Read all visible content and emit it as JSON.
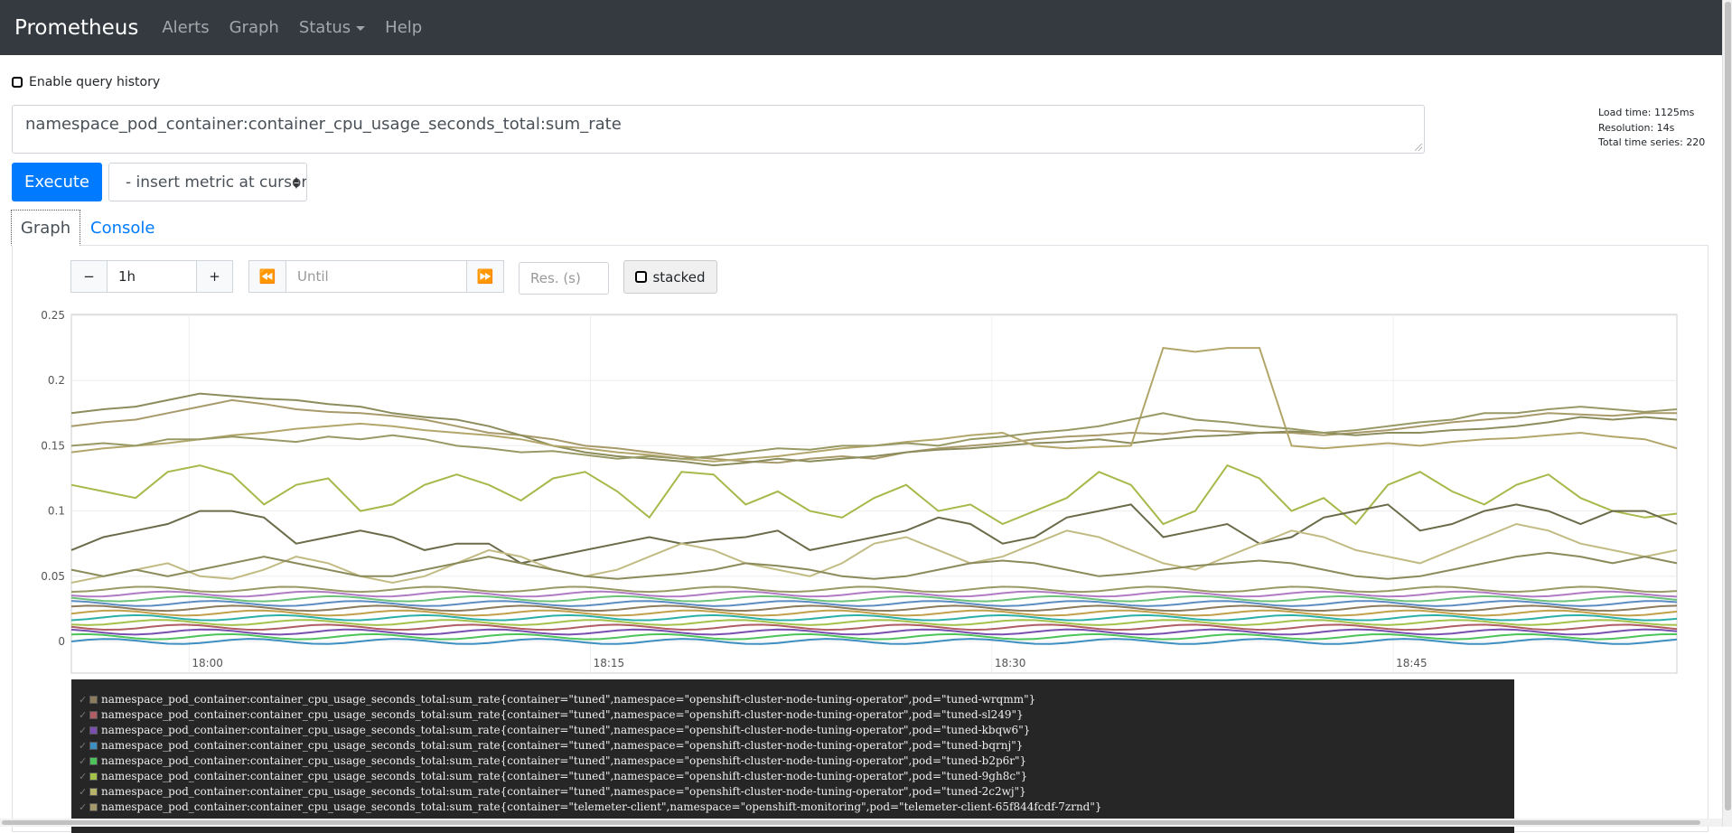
{
  "navbar": {
    "brand": "Prometheus",
    "links": [
      "Alerts",
      "Graph",
      "Status",
      "Help"
    ]
  },
  "query": {
    "history_label": "Enable query history",
    "history_checked": false,
    "expression": "namespace_pod_container:container_cpu_usage_seconds_total:sum_rate",
    "execute_label": "Execute",
    "metric_select_label": "- insert metric at cursor -",
    "stats": {
      "load_time": "Load time: 1125ms",
      "resolution": "Resolution: 14s",
      "total_series": "Total time series: 220"
    }
  },
  "tabs": {
    "graph": "Graph",
    "console": "Console"
  },
  "graph_controls": {
    "minus": "−",
    "range": "1h",
    "plus": "+",
    "back_icon": "double-left-icon",
    "until_placeholder": "Until",
    "forward_icon": "double-right-icon",
    "res_placeholder": "Res. (s)",
    "stacked_label": "stacked",
    "stacked_checked": false
  },
  "chart_data": {
    "type": "line",
    "y_ticks": [
      "0",
      "0.05",
      "0.1",
      "0.15",
      "0.2",
      "0.25"
    ],
    "ylim": [
      0,
      0.25
    ],
    "x_ticks": [
      "18:00",
      "18:15",
      "18:30",
      "18:45"
    ],
    "x_tick_minutes": [
      4.4,
      19.4,
      34.4,
      49.4
    ],
    "x_range_minutes": [
      0,
      60
    ],
    "grid": true,
    "series_count_shown": 220,
    "series": [
      {
        "color": "#a89a6a",
        "values": [
          0.165,
          0.168,
          0.17,
          0.175,
          0.18,
          0.185,
          0.182,
          0.178,
          0.176,
          0.175,
          0.173,
          0.17,
          0.165,
          0.16,
          0.158,
          0.155,
          0.15,
          0.148,
          0.145,
          0.142,
          0.14,
          0.138,
          0.137,
          0.14,
          0.142,
          0.14,
          0.145,
          0.148,
          0.15,
          0.152,
          0.155,
          0.157,
          0.158,
          0.16,
          0.159,
          0.162,
          0.161,
          0.16,
          0.16,
          0.158,
          0.16,
          0.162,
          0.165,
          0.168,
          0.17,
          0.172,
          0.175,
          0.174,
          0.173,
          0.175,
          0.175
        ]
      },
      {
        "color": "#8c8c5c",
        "values": [
          0.175,
          0.178,
          0.18,
          0.185,
          0.19,
          0.188,
          0.186,
          0.185,
          0.182,
          0.18,
          0.175,
          0.172,
          0.17,
          0.165,
          0.158,
          0.15,
          0.145,
          0.142,
          0.14,
          0.138,
          0.135,
          0.137,
          0.14,
          0.138,
          0.14,
          0.142,
          0.145,
          0.147,
          0.148,
          0.15,
          0.152,
          0.153,
          0.155,
          0.152,
          0.155,
          0.157,
          0.158,
          0.16,
          0.161,
          0.16,
          0.158,
          0.16,
          0.16,
          0.162,
          0.163,
          0.165,
          0.168,
          0.172,
          0.17,
          0.172,
          0.17
        ]
      },
      {
        "color": "#b3a66a",
        "values": [
          0.145,
          0.148,
          0.15,
          0.152,
          0.155,
          0.158,
          0.16,
          0.163,
          0.165,
          0.167,
          0.165,
          0.162,
          0.16,
          0.158,
          0.155,
          0.15,
          0.148,
          0.145,
          0.143,
          0.14,
          0.138,
          0.14,
          0.142,
          0.145,
          0.148,
          0.15,
          0.153,
          0.155,
          0.158,
          0.16,
          0.15,
          0.148,
          0.149,
          0.15,
          0.225,
          0.222,
          0.225,
          0.225,
          0.15,
          0.148,
          0.15,
          0.152,
          0.15,
          0.153,
          0.155,
          0.156,
          0.158,
          0.16,
          0.157,
          0.155,
          0.148
        ]
      },
      {
        "color": "#999966",
        "values": [
          0.15,
          0.152,
          0.15,
          0.155,
          0.155,
          0.157,
          0.155,
          0.153,
          0.157,
          0.155,
          0.158,
          0.155,
          0.15,
          0.148,
          0.145,
          0.146,
          0.143,
          0.14,
          0.142,
          0.14,
          0.142,
          0.145,
          0.148,
          0.147,
          0.15,
          0.15,
          0.152,
          0.15,
          0.155,
          0.157,
          0.16,
          0.162,
          0.165,
          0.17,
          0.175,
          0.17,
          0.168,
          0.165,
          0.163,
          0.16,
          0.162,
          0.165,
          0.168,
          0.17,
          0.175,
          0.175,
          0.178,
          0.18,
          0.178,
          0.176,
          0.178
        ]
      },
      {
        "color": "#a8b84a",
        "values": [
          0.12,
          0.115,
          0.11,
          0.13,
          0.135,
          0.128,
          0.105,
          0.12,
          0.125,
          0.1,
          0.105,
          0.12,
          0.128,
          0.12,
          0.108,
          0.125,
          0.13,
          0.115,
          0.095,
          0.13,
          0.128,
          0.105,
          0.115,
          0.1,
          0.095,
          0.11,
          0.12,
          0.1,
          0.105,
          0.09,
          0.1,
          0.11,
          0.13,
          0.12,
          0.09,
          0.1,
          0.135,
          0.125,
          0.1,
          0.11,
          0.09,
          0.12,
          0.13,
          0.115,
          0.105,
          0.12,
          0.128,
          0.11,
          0.1,
          0.095,
          0.098
        ]
      },
      {
        "color": "#6b6b4a",
        "values": [
          0.07,
          0.08,
          0.085,
          0.09,
          0.1,
          0.1,
          0.095,
          0.075,
          0.08,
          0.085,
          0.08,
          0.07,
          0.075,
          0.075,
          0.06,
          0.065,
          0.07,
          0.075,
          0.08,
          0.075,
          0.078,
          0.08,
          0.085,
          0.07,
          0.075,
          0.08,
          0.085,
          0.095,
          0.09,
          0.075,
          0.08,
          0.095,
          0.1,
          0.105,
          0.08,
          0.085,
          0.09,
          0.075,
          0.08,
          0.095,
          0.1,
          0.105,
          0.085,
          0.09,
          0.1,
          0.105,
          0.1,
          0.09,
          0.1,
          0.1,
          0.09
        ]
      },
      {
        "color": "#c2bb84",
        "values": [
          0.045,
          0.05,
          0.055,
          0.06,
          0.05,
          0.048,
          0.055,
          0.065,
          0.06,
          0.05,
          0.045,
          0.05,
          0.06,
          0.07,
          0.065,
          0.055,
          0.05,
          0.055,
          0.065,
          0.075,
          0.07,
          0.06,
          0.055,
          0.05,
          0.06,
          0.075,
          0.08,
          0.07,
          0.06,
          0.065,
          0.075,
          0.085,
          0.08,
          0.07,
          0.06,
          0.055,
          0.065,
          0.075,
          0.085,
          0.08,
          0.07,
          0.065,
          0.06,
          0.07,
          0.08,
          0.09,
          0.085,
          0.075,
          0.07,
          0.065,
          0.07
        ]
      },
      {
        "color": "#8a8a5a",
        "values": [
          0.055,
          0.05,
          0.055,
          0.05,
          0.055,
          0.06,
          0.065,
          0.06,
          0.055,
          0.05,
          0.05,
          0.055,
          0.06,
          0.065,
          0.06,
          0.055,
          0.05,
          0.048,
          0.05,
          0.052,
          0.055,
          0.06,
          0.058,
          0.055,
          0.05,
          0.048,
          0.05,
          0.055,
          0.06,
          0.062,
          0.06,
          0.055,
          0.05,
          0.052,
          0.055,
          0.058,
          0.06,
          0.062,
          0.06,
          0.055,
          0.05,
          0.048,
          0.05,
          0.055,
          0.06,
          0.065,
          0.068,
          0.065,
          0.06,
          0.065,
          0.06
        ]
      }
    ],
    "flat_series_count": 12,
    "flat_band_range": [
      0.0,
      0.04
    ]
  },
  "legend": {
    "items": [
      {
        "label": "namespace_pod_container:container_cpu_usage_seconds_total:sum_rate{container=\"tuned\",namespace=\"openshift-cluster-node-tuning-operator\",pod=\"tuned-wrqmm\"}",
        "color": "#8c7b5c"
      },
      {
        "label": "namespace_pod_container:container_cpu_usage_seconds_total:sum_rate{container=\"tuned\",namespace=\"openshift-cluster-node-tuning-operator\",pod=\"tuned-sl249\"}",
        "color": "#b05e63"
      },
      {
        "label": "namespace_pod_container:container_cpu_usage_seconds_total:sum_rate{container=\"tuned\",namespace=\"openshift-cluster-node-tuning-operator\",pod=\"tuned-kbqw6\"}",
        "color": "#7b4fb0"
      },
      {
        "label": "namespace_pod_container:container_cpu_usage_seconds_total:sum_rate{container=\"tuned\",namespace=\"openshift-cluster-node-tuning-operator\",pod=\"tuned-bqrnj\"}",
        "color": "#3d8fc2"
      },
      {
        "label": "namespace_pod_container:container_cpu_usage_seconds_total:sum_rate{container=\"tuned\",namespace=\"openshift-cluster-node-tuning-operator\",pod=\"tuned-b2p6r\"}",
        "color": "#4cc45a"
      },
      {
        "label": "namespace_pod_container:container_cpu_usage_seconds_total:sum_rate{container=\"tuned\",namespace=\"openshift-cluster-node-tuning-operator\",pod=\"tuned-9gh8c\"}",
        "color": "#a3c24a"
      },
      {
        "label": "namespace_pod_container:container_cpu_usage_seconds_total:sum_rate{container=\"tuned\",namespace=\"openshift-cluster-node-tuning-operator\",pod=\"tuned-2c2wj\"}",
        "color": "#b8b36a"
      },
      {
        "label": "namespace_pod_container:container_cpu_usage_seconds_total:sum_rate{container=\"telemeter-client\",namespace=\"openshift-monitoring\",pod=\"telemeter-client-65f844fcdf-7zrnd\"}",
        "color": "#a49a6b"
      }
    ]
  }
}
